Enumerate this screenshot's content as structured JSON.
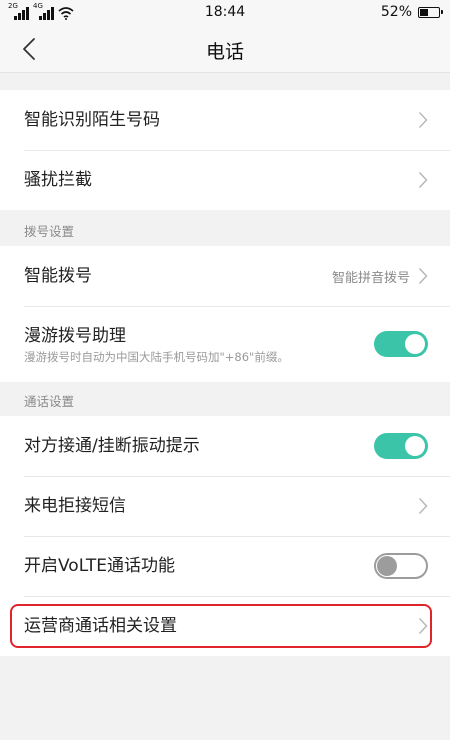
{
  "status_bar": {
    "sim1_tag": "2G",
    "sim2_tag": "4G",
    "time": "18:44",
    "battery_percent": "52%",
    "battery_level": 0.52
  },
  "header": {
    "title": "电话",
    "back_icon": "chevron-left-icon"
  },
  "group1": {
    "items": [
      {
        "label": "智能识别陌生号码"
      },
      {
        "label": "骚扰拦截"
      }
    ]
  },
  "dial_section": {
    "title": "拨号设置",
    "smart_dial": {
      "label": "智能拨号",
      "value": "智能拼音拨号"
    },
    "roaming": {
      "label": "漫游拨号助理",
      "description": "漫游拨号时自动为中国大陆手机号码加\"+86\"前缀。",
      "enabled": true
    }
  },
  "call_section": {
    "title": "通话设置",
    "vibrate": {
      "label": "对方接通/挂断振动提示",
      "enabled": true
    },
    "reject_sms": {
      "label": "来电拒接短信"
    },
    "volte": {
      "label": "开启VoLTE通话功能",
      "enabled": false
    },
    "carrier": {
      "label": "运营商通话相关设置"
    }
  },
  "colors": {
    "accent": "#3cc4a8",
    "highlight": "#e0242c",
    "background": "#f2f2f2"
  }
}
